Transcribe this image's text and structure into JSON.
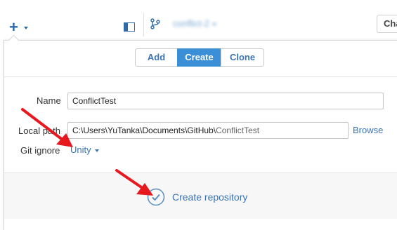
{
  "toolbar": {
    "add_icon": "plus-icon",
    "sidebar_icon": "sidebar-toggle-icon",
    "branch_icon": "branch-icon",
    "branch_name": "conflict-2",
    "changes_label": "Cha"
  },
  "tabs": [
    {
      "label": "Add",
      "active": false
    },
    {
      "label": "Create",
      "active": true
    },
    {
      "label": "Clone",
      "active": false
    }
  ],
  "form": {
    "name_label": "Name",
    "name_value": "ConflictTest",
    "local_path_label": "Local path",
    "local_path_prefix": "C:\\Users\\YuTanka\\Documents\\GitHub\\",
    "local_path_suffix": "ConflictTest",
    "browse_label": "Browse",
    "git_ignore_label": "Git ignore",
    "git_ignore_value": "Unity"
  },
  "create_repository": {
    "label": "Create repository",
    "icon": "check-circle-icon"
  },
  "colors": {
    "accent": "#3a8fd6",
    "link": "#3a74b4",
    "annotation_arrow": "#e8181f"
  }
}
